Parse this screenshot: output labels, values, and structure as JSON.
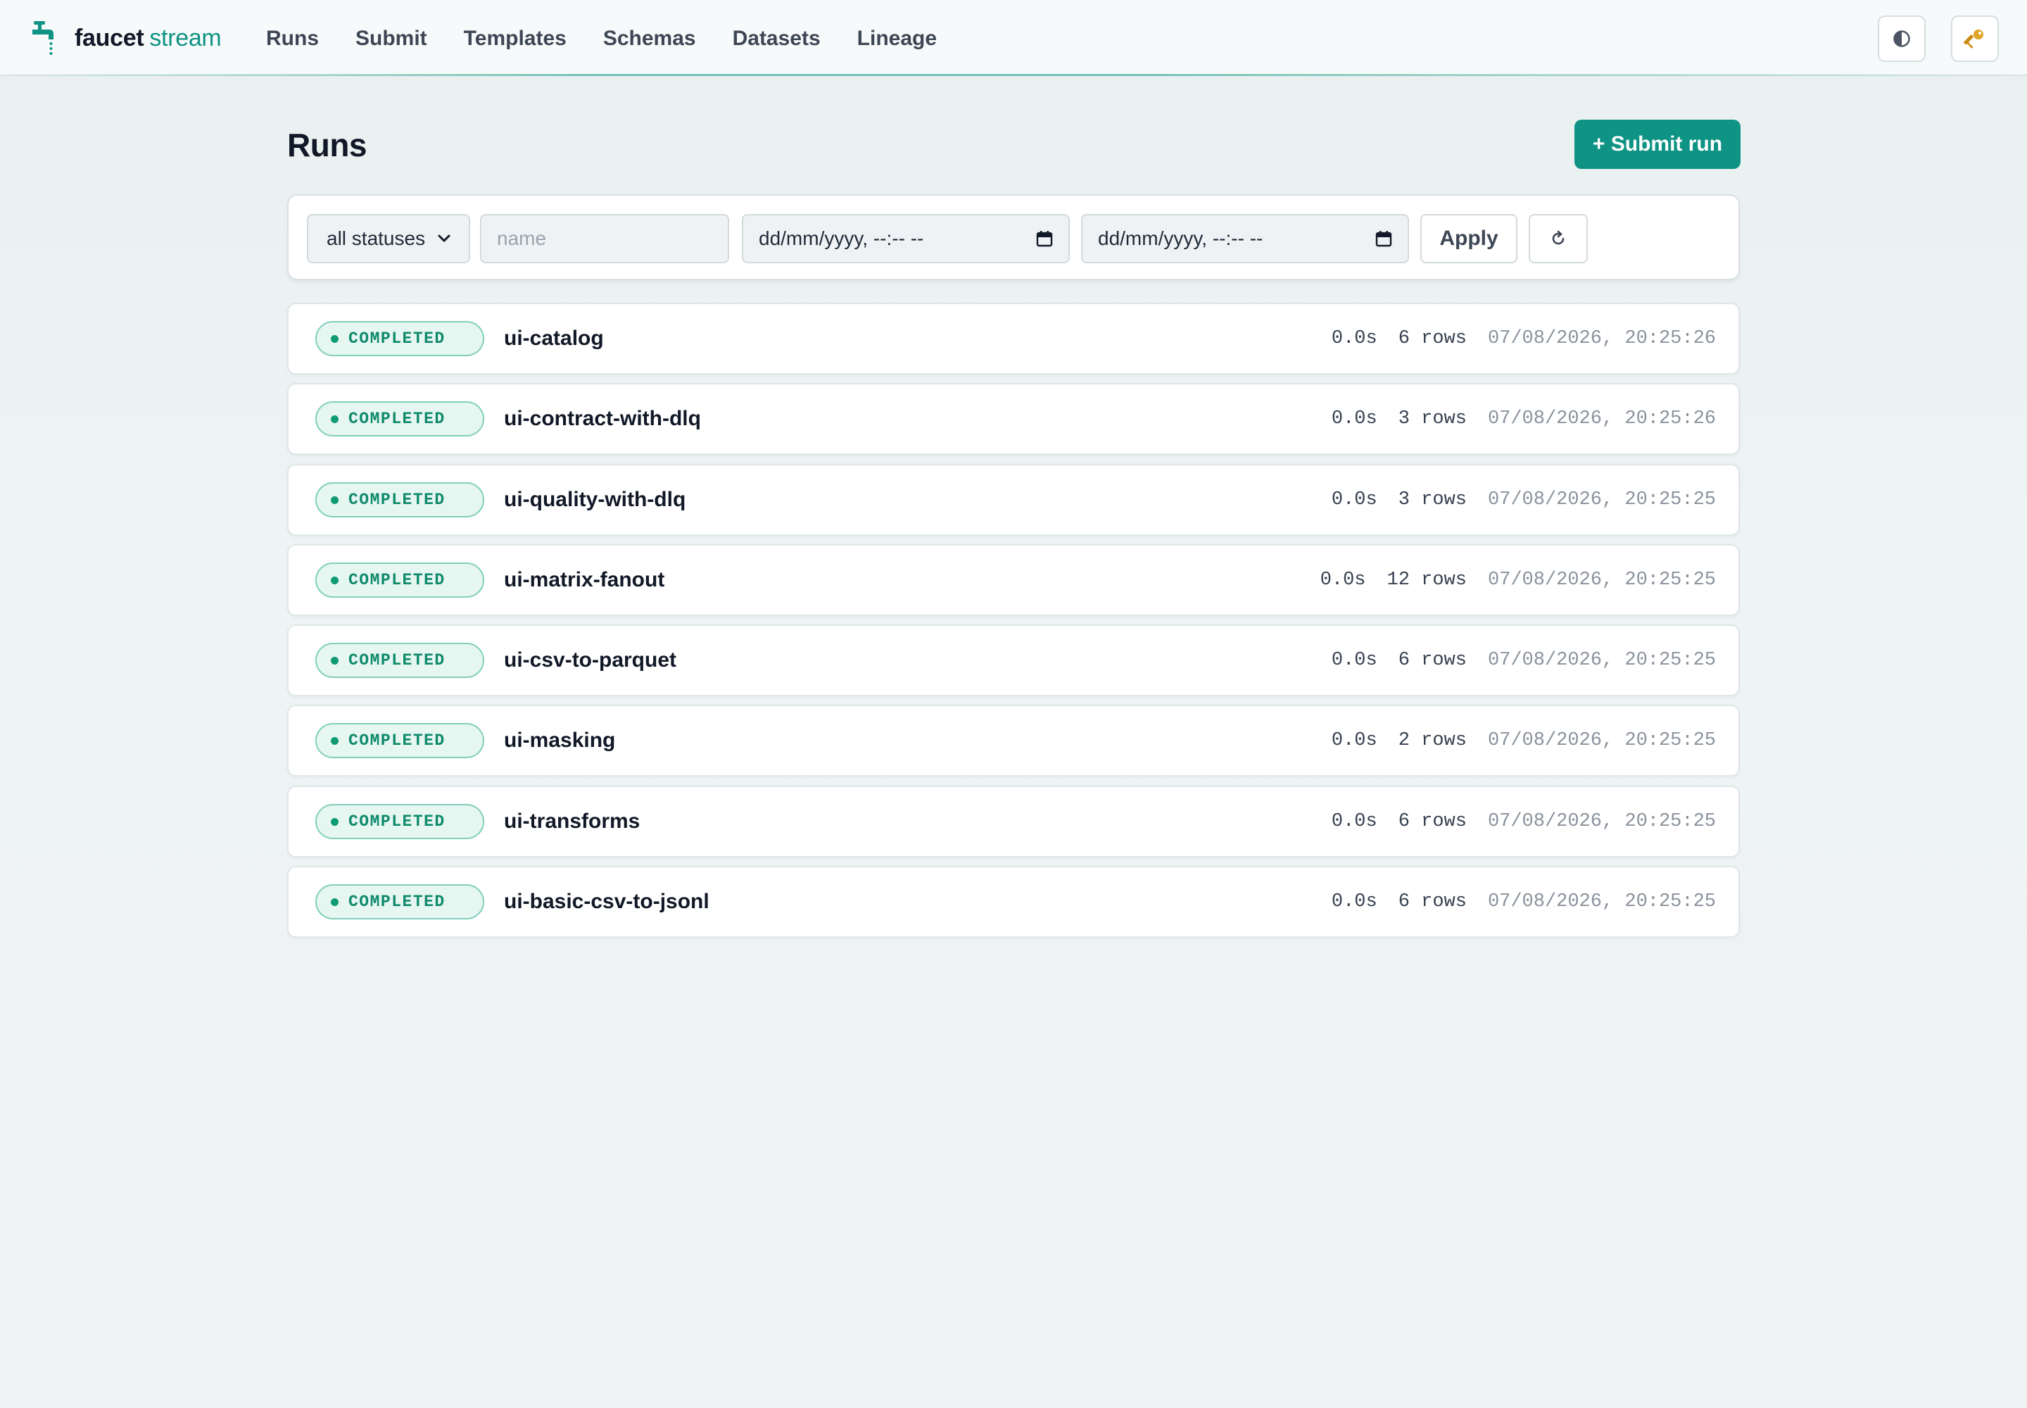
{
  "header": {
    "brand": {
      "name": "faucet",
      "accent": "stream"
    },
    "nav": [
      {
        "label": "Runs"
      },
      {
        "label": "Submit"
      },
      {
        "label": "Templates"
      },
      {
        "label": "Schemas"
      },
      {
        "label": "Datasets"
      },
      {
        "label": "Lineage"
      }
    ],
    "icons": {
      "theme": "contrast-icon",
      "key": "key-icon"
    }
  },
  "page": {
    "title": "Runs",
    "submit_label": "+ Submit run"
  },
  "filters": {
    "status": {
      "selected": "all statuses"
    },
    "name": {
      "placeholder": "name",
      "value": ""
    },
    "from": {
      "placeholder": "dd/mm/yyyy, --:-- --"
    },
    "to": {
      "placeholder": "dd/mm/yyyy, --:-- --"
    },
    "apply_label": "Apply"
  },
  "runs": [
    {
      "status": "COMPLETED",
      "name": "ui-catalog",
      "duration": "0.0s",
      "rows": "6 rows",
      "timestamp": "07/08/2026, 20:25:26"
    },
    {
      "status": "COMPLETED",
      "name": "ui-contract-with-dlq",
      "duration": "0.0s",
      "rows": "3 rows",
      "timestamp": "07/08/2026, 20:25:26"
    },
    {
      "status": "COMPLETED",
      "name": "ui-quality-with-dlq",
      "duration": "0.0s",
      "rows": "3 rows",
      "timestamp": "07/08/2026, 20:25:25"
    },
    {
      "status": "COMPLETED",
      "name": "ui-matrix-fanout",
      "duration": "0.0s",
      "rows": "12 rows",
      "timestamp": "07/08/2026, 20:25:25"
    },
    {
      "status": "COMPLETED",
      "name": "ui-csv-to-parquet",
      "duration": "0.0s",
      "rows": "6 rows",
      "timestamp": "07/08/2026, 20:25:25"
    },
    {
      "status": "COMPLETED",
      "name": "ui-masking",
      "duration": "0.0s",
      "rows": "2 rows",
      "timestamp": "07/08/2026, 20:25:25"
    },
    {
      "status": "COMPLETED",
      "name": "ui-transforms",
      "duration": "0.0s",
      "rows": "6 rows",
      "timestamp": "07/08/2026, 20:25:25"
    },
    {
      "status": "COMPLETED",
      "name": "ui-basic-csv-to-jsonl",
      "duration": "0.0s",
      "rows": "6 rows",
      "timestamp": "07/08/2026, 20:25:25"
    }
  ],
  "colors": {
    "accent": "#0e9384",
    "status_completed_text": "#0e8a6b",
    "status_completed_bg": "#e6f6f1",
    "status_completed_border": "#7fcfbc"
  }
}
